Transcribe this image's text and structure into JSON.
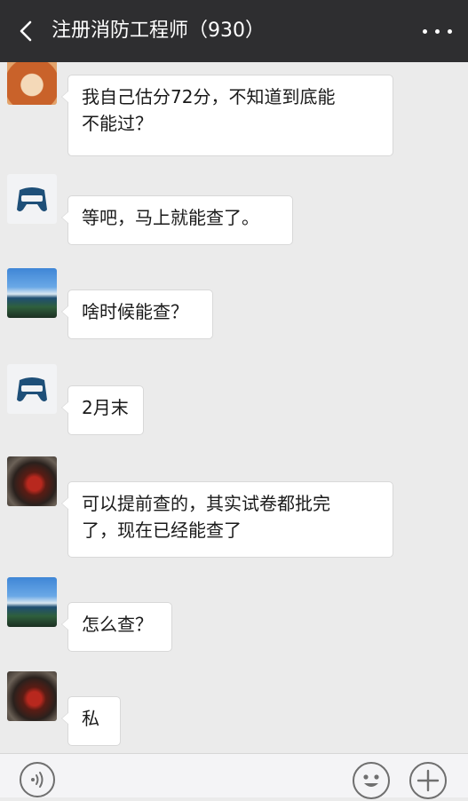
{
  "header": {
    "title": "注册消防工程师（930）",
    "back_icon": "chevron-left-icon",
    "more_icon": "more-dots-icon"
  },
  "messages": [
    {
      "sender": "",
      "avatar": "fox-avatar",
      "text_lines": [
        "我自己估分72分，不知道到底能",
        "不能过？"
      ]
    },
    {
      "sender": "",
      "avatar": "game-controller-avatar",
      "text_lines": [
        "等吧，马上就能查了。"
      ]
    },
    {
      "sender": "",
      "avatar": "landscape-avatar",
      "text_lines": [
        "啥时候能查？"
      ]
    },
    {
      "sender": "",
      "avatar": "game-controller-avatar",
      "text_lines": [
        "2月末"
      ]
    },
    {
      "sender": "",
      "avatar": "photo-avatar",
      "text_lines": [
        "可以提前查的，其实试卷都批完",
        "了，现在已经能查了"
      ]
    },
    {
      "sender": "",
      "avatar": "landscape-avatar",
      "text_lines": [
        "怎么查？"
      ]
    },
    {
      "sender": "",
      "avatar": "photo-avatar",
      "text_lines": [
        "私"
      ]
    }
  ],
  "bottom": {
    "voice_icon": "voice-icon",
    "emoji_icon": "emoji-icon",
    "plus_icon": "plus-icon"
  },
  "colors": {
    "title_bar": "#2e2e30",
    "chat_background": "#ebebeb",
    "bubble": "#ffffff"
  }
}
